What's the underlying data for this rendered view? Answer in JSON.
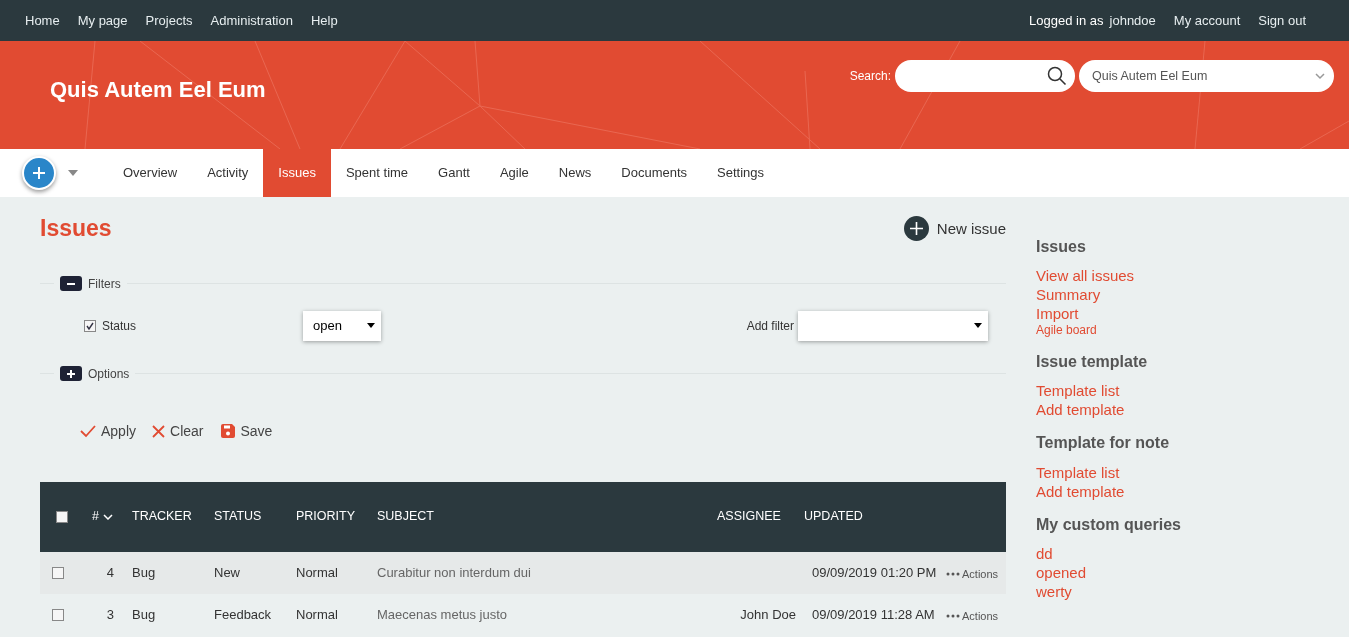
{
  "top_menu": [
    {
      "label": "Home"
    },
    {
      "label": "My page"
    },
    {
      "label": "Projects"
    },
    {
      "label": "Administration"
    },
    {
      "label": "Help"
    }
  ],
  "account": {
    "logged_in_label": "Logged in as",
    "user": "johndoe",
    "links": [
      "My account",
      "Sign out"
    ]
  },
  "project_title": "Quis Autem Eel Eum",
  "search": {
    "label": "Search:"
  },
  "project_select": {
    "value": "Quis Autem Eel Eum"
  },
  "tabs": [
    {
      "label": "Overview",
      "selected": false
    },
    {
      "label": "Activity",
      "selected": false
    },
    {
      "label": "Issues",
      "selected": true
    },
    {
      "label": "Spent time",
      "selected": false
    },
    {
      "label": "Gantt",
      "selected": false
    },
    {
      "label": "Agile",
      "selected": false
    },
    {
      "label": "News",
      "selected": false
    },
    {
      "label": "Documents",
      "selected": false
    },
    {
      "label": "Settings",
      "selected": false
    }
  ],
  "page_title": "Issues",
  "new_issue": "New issue",
  "filters": {
    "legend": "Filters",
    "expanded": true,
    "rows": [
      {
        "label": "Status",
        "checked": true,
        "operator": "open"
      }
    ],
    "add_filter_label": "Add filter"
  },
  "options": {
    "legend": "Options",
    "expanded": false
  },
  "actions": [
    {
      "label": "Apply",
      "kind": "apply"
    },
    {
      "label": "Clear",
      "kind": "clear"
    },
    {
      "label": "Save",
      "kind": "save"
    }
  ],
  "table": {
    "all_checked": false,
    "columns": [
      "#",
      "TRACKER",
      "STATUS",
      "PRIORITY",
      "SUBJECT",
      "ASSIGNEE",
      "UPDATED"
    ],
    "rows": [
      {
        "id": "4",
        "tracker": "Bug",
        "status": "New",
        "priority": "Normal",
        "subject": "Curabitur non interdum dui",
        "assignee": "",
        "updated": "09/09/2019 01:20 PM",
        "actions": "Actions",
        "checked": false
      },
      {
        "id": "3",
        "tracker": "Bug",
        "status": "Feedback",
        "priority": "Normal",
        "subject": "Maecenas metus justo",
        "assignee": "John Doe",
        "updated": "09/09/2019 11:28 AM",
        "actions": "Actions",
        "checked": false
      }
    ]
  },
  "sidebar": [
    {
      "title": "Issues",
      "links": [
        {
          "label": "View all issues",
          "kind": "normal"
        },
        {
          "label": "Summary",
          "kind": "normal"
        },
        {
          "label": "Import",
          "kind": "normal"
        },
        {
          "label": "Agile board",
          "kind": "small"
        }
      ]
    },
    {
      "title": "Issue template",
      "links": [
        {
          "label": "Template list",
          "kind": "normal"
        },
        {
          "label": "Add template",
          "kind": "normal"
        }
      ]
    },
    {
      "title": "Template for note",
      "links": [
        {
          "label": "Template list",
          "kind": "normal"
        },
        {
          "label": "Add template",
          "kind": "normal"
        }
      ]
    },
    {
      "title": "My custom queries",
      "links": [
        {
          "label": "dd",
          "kind": "normal"
        },
        {
          "label": "opened",
          "kind": "normal"
        },
        {
          "label": "werty",
          "kind": "normal"
        }
      ]
    }
  ]
}
